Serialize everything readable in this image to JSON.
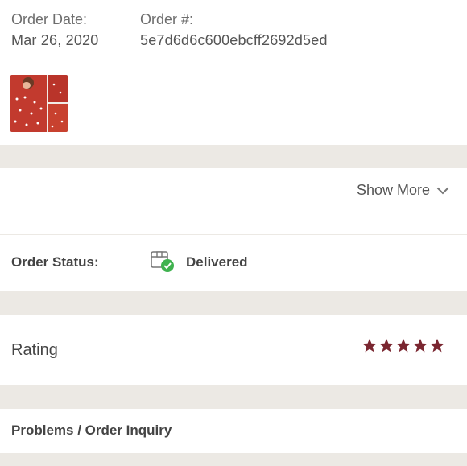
{
  "order": {
    "date_label": "Order Date:",
    "date_value": "Mar 26, 2020",
    "number_label": "Order #:",
    "number_value": "5e7d6d6c600ebcff2692d5ed",
    "item_image_icon": "red-floral-dress-thumbnail"
  },
  "details": {
    "show_more_label": "Show More",
    "show_more_icon": "chevron-down-icon"
  },
  "status": {
    "label": "Order Status:",
    "value": "Delivered",
    "icon": "delivered-box-check-icon",
    "check_color": "#3fb24f"
  },
  "rating": {
    "label": "Rating",
    "stars_filled": 5,
    "stars_total": 5,
    "star_color": "#7a2630"
  },
  "problems": {
    "label": "Problems / Order Inquiry"
  }
}
